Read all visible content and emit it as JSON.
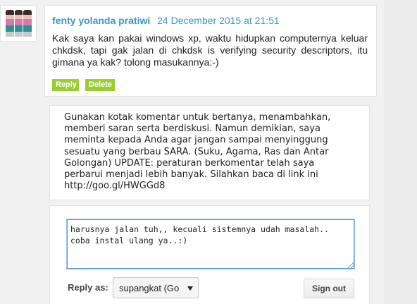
{
  "comment": {
    "author": "fenty yolanda pratiwi",
    "date": "24 December 2015 at 21:51",
    "body": "Kak saya kan pakai windows xp, waktu hidupkan computernya keluar chkdsk, tapi gak jalan di chkdsk is verifying security descriptors, itu gimana ya kak? tolong masukannya:-)",
    "reply_label": "Reply",
    "delete_label": "Delete",
    "avatar_icon": "user-avatar-icon"
  },
  "notice": {
    "text": "Gunakan kotak komentar untuk bertanya, menambahkan, memberi saran serta berdiskusi. Namun demikian, saya meminta kepada Anda agar jangan sampai menyinggung sesuatu yang berbau SARA. (Suku, Agama, Ras dan Antar Golongan) UPDATE: peraturan berkomentar telah saya perbarui menjadi lebih banyak. Silahkan baca di link ini http://goo.gl/HWGGd8"
  },
  "reply_form": {
    "text_value": "harusnya jalan tuh,, kecuali sistemnya udah masalah.. coba instal ulang ya..:)",
    "reply_as_label": "Reply as:",
    "identity_selected": "supangkat (Go",
    "signout_label": "Sign out"
  },
  "colors": {
    "link": "#3a97c9",
    "action_button": "#9acd32",
    "focus_border": "#5b95d6"
  }
}
